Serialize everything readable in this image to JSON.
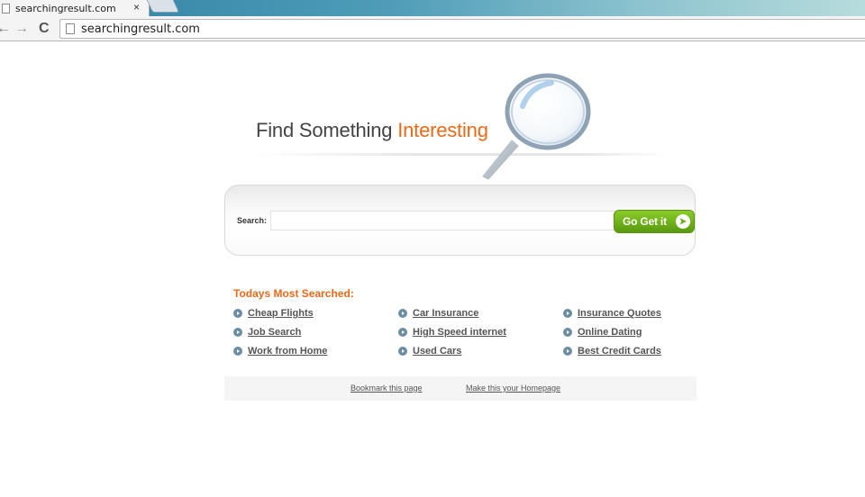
{
  "browser": {
    "tab_title": "searchingresult.com",
    "tab_close": "×",
    "url": "searchingresult.com",
    "nav": {
      "back": "←",
      "forward": "→",
      "reload": "C"
    }
  },
  "hero": {
    "headline_plain": "Find Something ",
    "headline_accent": "Interesting"
  },
  "search": {
    "label": "Search:",
    "value": "",
    "placeholder": "",
    "button_label": "Go Get it",
    "button_icon": "arrow-right-icon"
  },
  "popular": {
    "title": "Todays Most Searched:",
    "links": [
      [
        "Cheap Flights",
        "Car Insurance",
        "Insurance Quotes"
      ],
      [
        "Job Search",
        "High Speed internet",
        "Online Dating"
      ],
      [
        "Work from Home",
        "Used Cars",
        "Best Credit Cards"
      ]
    ]
  },
  "footer": {
    "bookmark": "Bookmark this page",
    "homepage": "Make this your Homepage"
  },
  "colors": {
    "accent": "#e86a1a",
    "button_green": "#6eb019",
    "link_gray": "#555555"
  }
}
